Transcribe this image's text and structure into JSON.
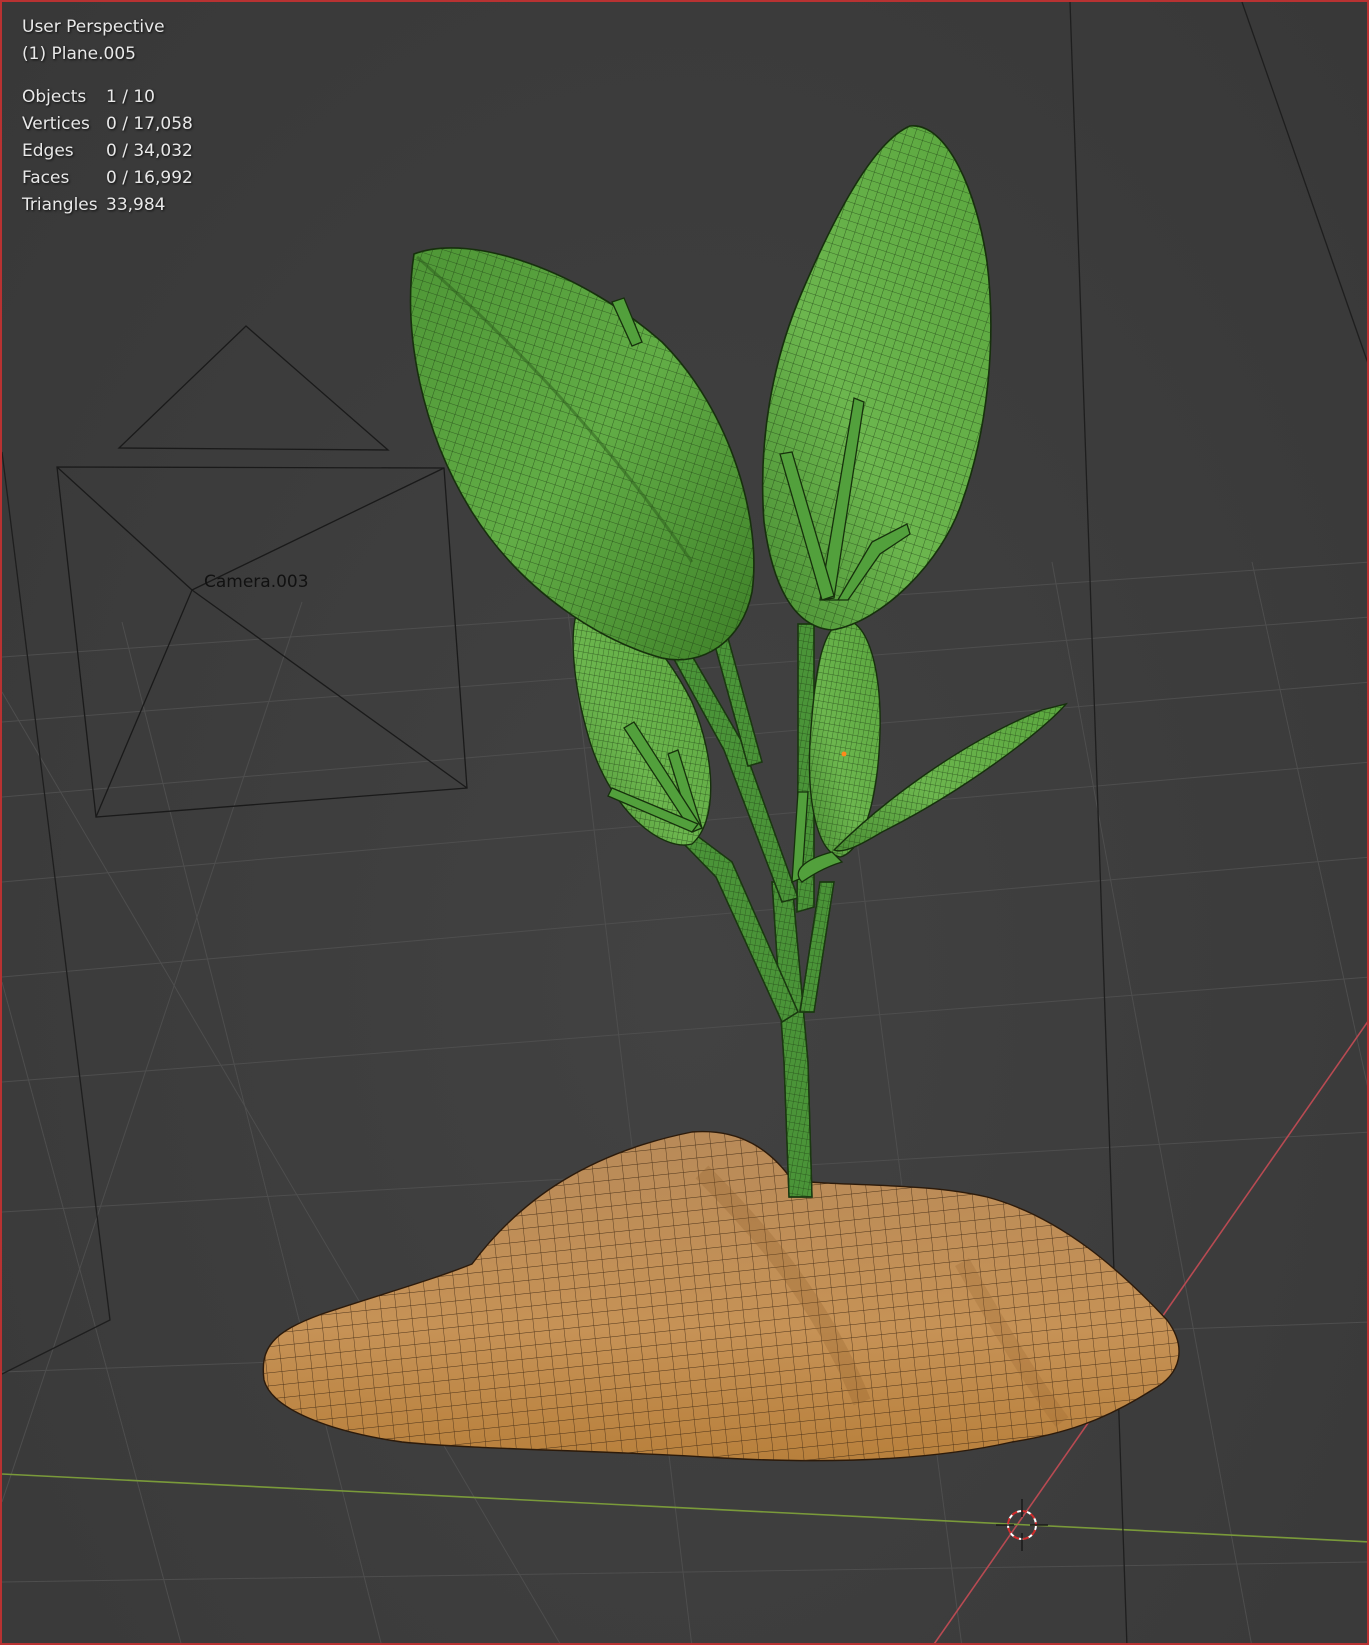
{
  "viewport": {
    "view_name": "User Perspective",
    "active_object": "(1) Plane.005"
  },
  "stats": [
    {
      "label": "Objects",
      "value": "1 / 10"
    },
    {
      "label": "Vertices",
      "value": "0 / 17,058"
    },
    {
      "label": "Edges",
      "value": "0 / 34,032"
    },
    {
      "label": "Faces",
      "value": "0 / 16,992"
    },
    {
      "label": "Triangles",
      "value": "33,984"
    }
  ],
  "scene": {
    "camera_label": "Camera.003"
  },
  "colors": {
    "background": "#3d3d3d",
    "grid_line": "#4e4e4e",
    "x_axis": "#b84a52",
    "y_axis": "#7a9a3a",
    "leaf": "#5aa040",
    "leaf_dark": "#3a7a2a",
    "stem": "#4a9438",
    "soil": "#c08a50",
    "soil_dark": "#9a6a32",
    "selection_border": "#b83232"
  },
  "icons": {
    "cursor": "3d-cursor-icon",
    "camera": "camera-object-icon"
  }
}
